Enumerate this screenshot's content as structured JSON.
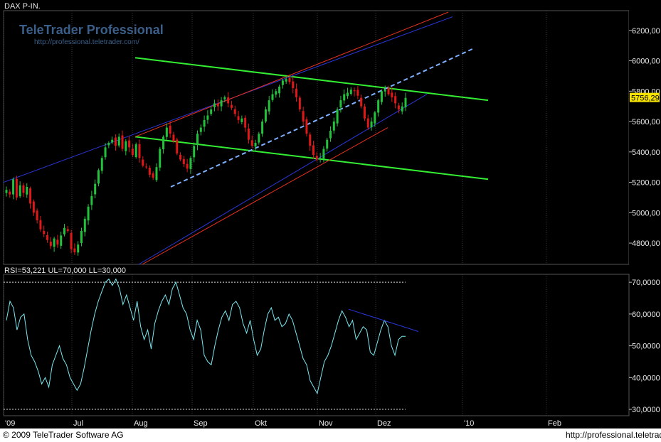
{
  "chart_data": [
    {
      "type": "candlestick",
      "title": "DAX P-IN.",
      "y_ticks": [
        "4800,00",
        "5000,00",
        "5200,00",
        "5400,00",
        "5600,00",
        "5800,00",
        "6000,00",
        "6200,00"
      ],
      "y_tick_values": [
        4800,
        5000,
        5200,
        5400,
        5600,
        5800,
        6000,
        6200
      ],
      "ylim": [
        4660,
        6330
      ],
      "last_value_label": "5756,29",
      "last_value": 5756.29,
      "x_labels": [
        "'09",
        "Jul",
        "Aug",
        "Sep",
        "Okt",
        "Nov",
        "Dez",
        "'10",
        "Feb"
      ],
      "series": [
        {
          "name": "close",
          "values": [
            5150,
            5120,
            5220,
            5100,
            5180,
            5130,
            5170,
            5060,
            5000,
            4950,
            4890,
            4860,
            4820,
            4780,
            4830,
            4790,
            4850,
            4900,
            4880,
            4760,
            4740,
            4790,
            4880,
            4960,
            5040,
            5110,
            5190,
            5280,
            5360,
            5430,
            5460,
            5480,
            5440,
            5500,
            5420,
            5470,
            5430,
            5380,
            5450,
            5360,
            5310,
            5300,
            5250,
            5230,
            5300,
            5420,
            5500,
            5560,
            5520,
            5470,
            5390,
            5350,
            5320,
            5290,
            5360,
            5440,
            5520,
            5560,
            5610,
            5640,
            5680,
            5720,
            5700,
            5740,
            5760,
            5720,
            5690,
            5650,
            5610,
            5620,
            5560,
            5480,
            5440,
            5460,
            5520,
            5600,
            5680,
            5740,
            5780,
            5800,
            5830,
            5870,
            5880,
            5860,
            5820,
            5760,
            5680,
            5600,
            5520,
            5440,
            5380,
            5350,
            5360,
            5420,
            5480,
            5540,
            5600,
            5680,
            5740,
            5780,
            5790,
            5810,
            5800,
            5770,
            5700,
            5620,
            5560,
            5600,
            5660,
            5740,
            5800,
            5810,
            5780,
            5760,
            5720,
            5680,
            5700,
            5756
          ]
        }
      ]
    },
    {
      "type": "line",
      "title": "RSI=53,221 UL=70,000 LL=30,000",
      "y_ticks": [
        "30,0000",
        "40,0000",
        "50,0000",
        "60,0000",
        "70,0000"
      ],
      "y_tick_values": [
        30,
        40,
        50,
        60,
        70
      ],
      "ylim": [
        28,
        72.5
      ],
      "upper_level": 70,
      "lower_level": 30,
      "x_labels": [
        "'09",
        "Jul",
        "Aug",
        "Sep",
        "Okt",
        "Nov",
        "Dez",
        "'10",
        "Feb"
      ],
      "series": [
        {
          "name": "RSI",
          "values": [
            58,
            64,
            62,
            55,
            59,
            60,
            52,
            47,
            45,
            42,
            38,
            40,
            37,
            44,
            47,
            50,
            46,
            44,
            40,
            38,
            36,
            38,
            43,
            49,
            55,
            60,
            64,
            67,
            70,
            71,
            69,
            71,
            68,
            63,
            66,
            62,
            58,
            64,
            56,
            52,
            55,
            49,
            57,
            61,
            64,
            66,
            63,
            68,
            70,
            66,
            62,
            60,
            55,
            52,
            58,
            55,
            47,
            45,
            44,
            50,
            55,
            59,
            61,
            58,
            63,
            64,
            62,
            57,
            54,
            58,
            52,
            47,
            49,
            55,
            60,
            62,
            58,
            59,
            56,
            57,
            60,
            58,
            54,
            50,
            46,
            44,
            39,
            37,
            35,
            40,
            45,
            47,
            50,
            54,
            58,
            61,
            59,
            56,
            58,
            52,
            54,
            56,
            55,
            48,
            47,
            51,
            55,
            58,
            56,
            50,
            47,
            52,
            53,
            53
          ]
        }
      ]
    }
  ],
  "header": {
    "title": "DAX P-IN."
  },
  "watermark": {
    "brand": "TeleTrader Professional",
    "url": "http://professional.teletrader.com/"
  },
  "footer": {
    "copyright": "© 2009 TeleTrader Software AG",
    "url": "http://professional.teletrader.com/"
  },
  "colors": {
    "up": "#23c23c",
    "down": "#e01818",
    "channel_green": "#33ee33",
    "trend_red": "#e83020",
    "trend_blue": "#2a36d8",
    "dashed": "#7fb0ff",
    "rsi": "#78e8f0"
  }
}
